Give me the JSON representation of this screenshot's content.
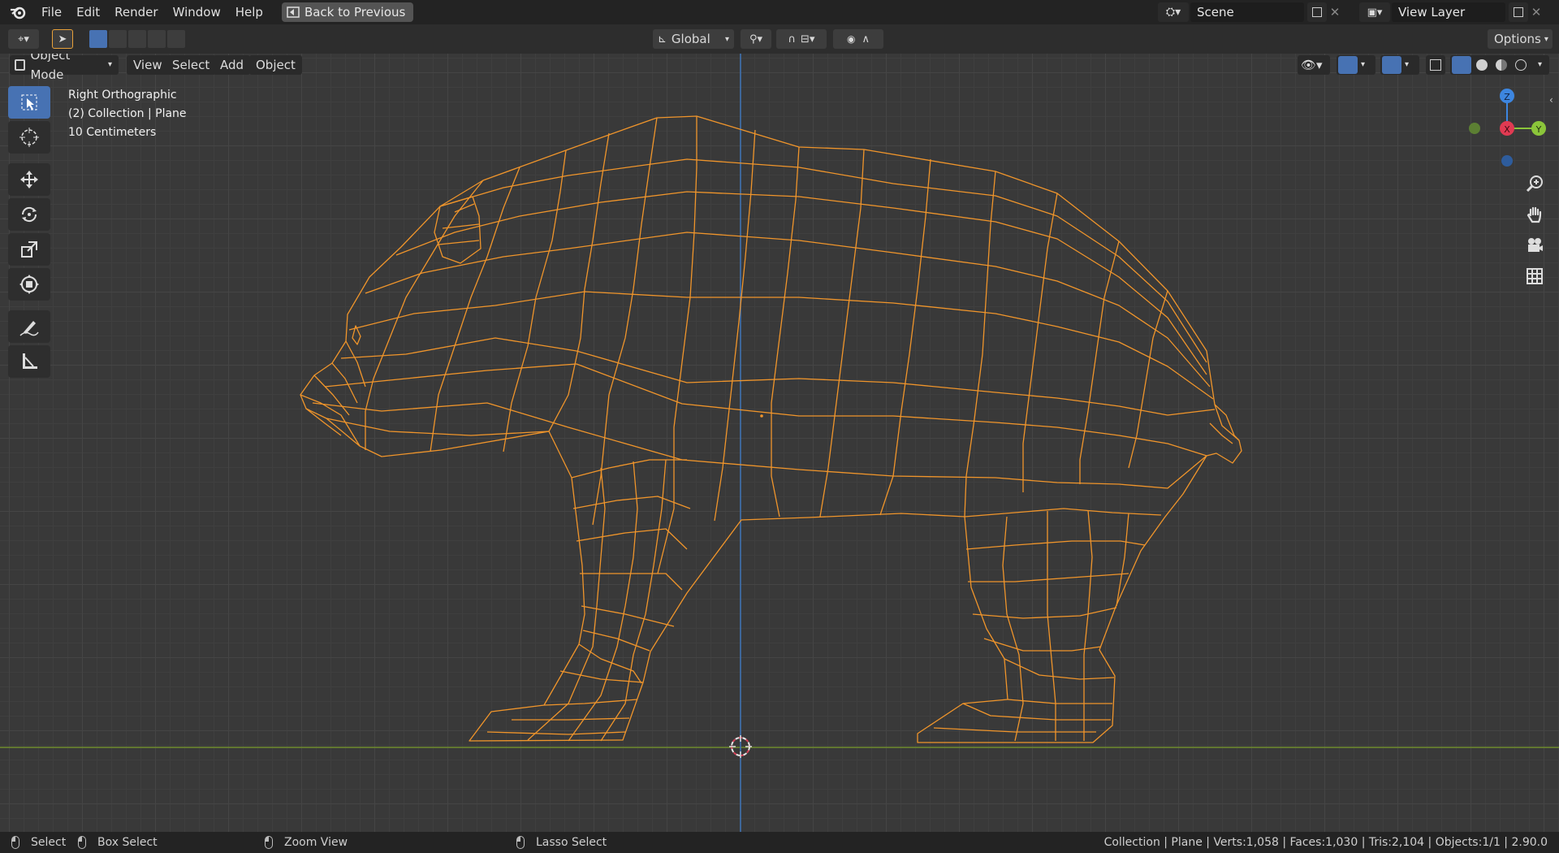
{
  "menu": {
    "items": [
      "File",
      "Edit",
      "Render",
      "Window",
      "Help"
    ],
    "back_button": "Back to Previous"
  },
  "scene": {
    "label": "Scene",
    "view_layer": "View Layer"
  },
  "tool_header": {
    "transform_orientation": "Global",
    "options": "Options"
  },
  "viewport_header": {
    "mode": "Object Mode",
    "view": "View",
    "select": "Select",
    "add": "Add",
    "object": "Object"
  },
  "overlay": {
    "view_name": "Right Orthographic",
    "collection": "(2) Collection | Plane",
    "scale": "10 Centimeters"
  },
  "gizmo": {
    "z": "Z",
    "x": "X",
    "y": "Y"
  },
  "status": {
    "select": "Select",
    "box_select": "Box Select",
    "zoom_view": "Zoom View",
    "lasso_select": "Lasso Select",
    "stats": "Collection | Plane | Verts:1,058 | Faces:1,030 | Tris:2,104 | Objects:1/1 | 2.90.0"
  },
  "colors": {
    "wire": "#f0952b",
    "active_tool": "#4772b3",
    "axis_x": "#e03a52",
    "axis_y": "#8bc53a",
    "axis_z": "#3d86e0",
    "ground_line": "#6f8a2e"
  },
  "icons": {
    "toolbar": [
      "select-box-icon",
      "cursor-icon",
      "move-icon",
      "rotate-icon",
      "scale-icon",
      "transform-icon",
      "annotate-icon",
      "measure-icon"
    ],
    "nav": [
      "zoom-icon",
      "hand-pan-icon",
      "camera-icon",
      "grid-icon"
    ]
  }
}
